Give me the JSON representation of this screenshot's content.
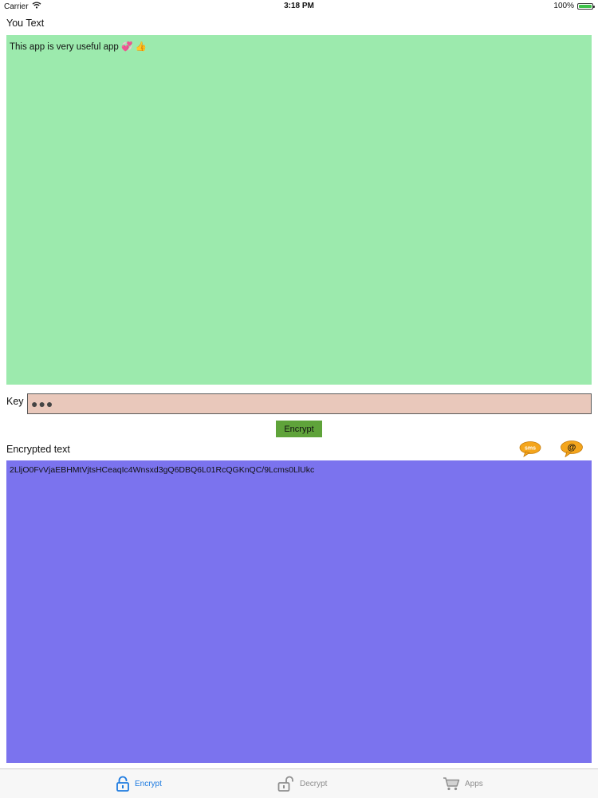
{
  "status_bar": {
    "carrier": "Carrier",
    "time": "3:18 PM",
    "battery": "100%",
    "icons": [
      "wifi-icon",
      "battery-icon"
    ]
  },
  "input_section": {
    "label": "You Text",
    "text": "This app is very useful app 💞 👍"
  },
  "key_section": {
    "label": "Key",
    "value": "●●●"
  },
  "encrypt_button": {
    "label": "Encrypt"
  },
  "output_section": {
    "label": "Encrypted text",
    "share_sms_label": "sms",
    "share_email_label": "@",
    "text": "2LljO0FvVjaEBHMtVjtsHCeaqIc4Wnsxd3gQ6DBQ6L01RcQGKnQC/9Lcms0LlUkc"
  },
  "tab_bar": {
    "tabs": [
      {
        "label": "Encrypt",
        "icon": "lock-open-icon",
        "selected": true
      },
      {
        "label": "Decrypt",
        "icon": "unlock-icon",
        "selected": false
      },
      {
        "label": "Apps",
        "icon": "cart-icon",
        "selected": false
      }
    ]
  },
  "colors": {
    "input_bg": "#9ceaad",
    "key_bg": "#e9c8bb",
    "button_bg": "#5fa33a",
    "output_bg": "#7b73ee",
    "tab_active": "#1e7be0",
    "tab_inactive": "#8e8e8e",
    "share_icon": "#f4a51c"
  }
}
